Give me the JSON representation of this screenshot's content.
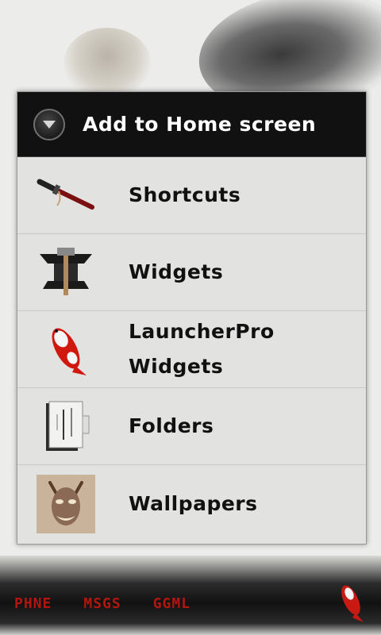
{
  "dialog": {
    "title": "Add to Home screen",
    "items": [
      {
        "label": "Shortcuts",
        "icon": "katana-icon"
      },
      {
        "label": "Widgets",
        "icon": "anvil-hammer-icon"
      },
      {
        "label": "LauncherPro Widgets",
        "icon": "koi-fish-icon"
      },
      {
        "label": "Folders",
        "icon": "scroll-folder-icon"
      },
      {
        "label": "Wallpapers",
        "icon": "hannya-mask-icon"
      }
    ]
  },
  "dock": {
    "labels": [
      "PHNE",
      "MSGS",
      "GGML"
    ]
  },
  "colors": {
    "dock_text": "#b3150f",
    "header_bg": "#111111",
    "list_bg": "#e2e2e0"
  }
}
